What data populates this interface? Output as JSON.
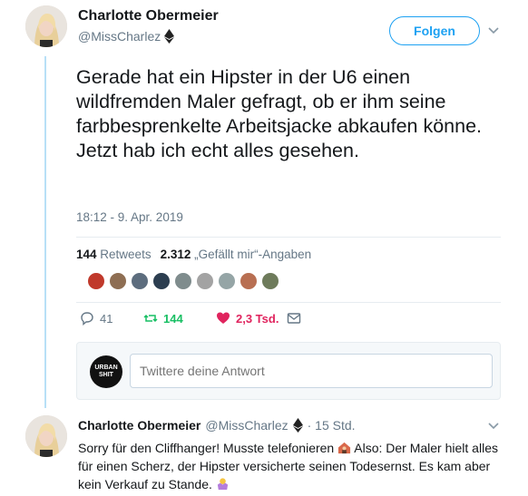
{
  "tweet": {
    "author_name": "Charlotte Obermeier",
    "author_handle": "@MissCharlez",
    "follow_label": "Folgen",
    "text": "Gerade hat ein Hipster in der U6 einen wildfremden Maler gefragt, ob er ihm seine farbbesprenkelte Arbeitsjacke abkaufen könne. Jetzt hab ich echt alles gesehen.",
    "timestamp": "18:12 - 9. Apr. 2019",
    "stats": {
      "retweets_count": "144",
      "retweets_label": "Retweets",
      "likes_count": "2.312",
      "likes_label": "„Gefällt mir“-Angaben"
    },
    "actions": {
      "replies": "41",
      "retweets": "144",
      "likes": "2,3 Tsd."
    },
    "liker_colors": [
      "#c0392b",
      "#8e6e53",
      "#5d6d7e",
      "#2c3e50",
      "#7f8c8d",
      "#a3a3a3",
      "#95a5a6",
      "#b86f52",
      "#6e7b5b"
    ]
  },
  "reply_box": {
    "account_logo_line1": "URBAN",
    "account_logo_line2": "SHIT",
    "placeholder": "Twittere deine Antwort"
  },
  "reply": {
    "author_name": "Charlotte Obermeier",
    "author_handle": "@MissCharlez",
    "age": "· 15 Std.",
    "text_part1": "Sorry für den Cliffhanger! Musste telefonieren",
    "text_part2": "Also: Der Maler hielt alles für einen Scherz, der Hipster versicherte seinen Todesernst. Es kam aber kein Verkauf zu Stande.",
    "emoji_1": "house-with-person-icon",
    "emoji_2": "person-shrugging-icon"
  },
  "colors": {
    "accent": "#1da1f2",
    "retweet": "#17bf63",
    "like": "#e0245e",
    "muted": "#657786",
    "thread_line": "#b8e0f7"
  }
}
